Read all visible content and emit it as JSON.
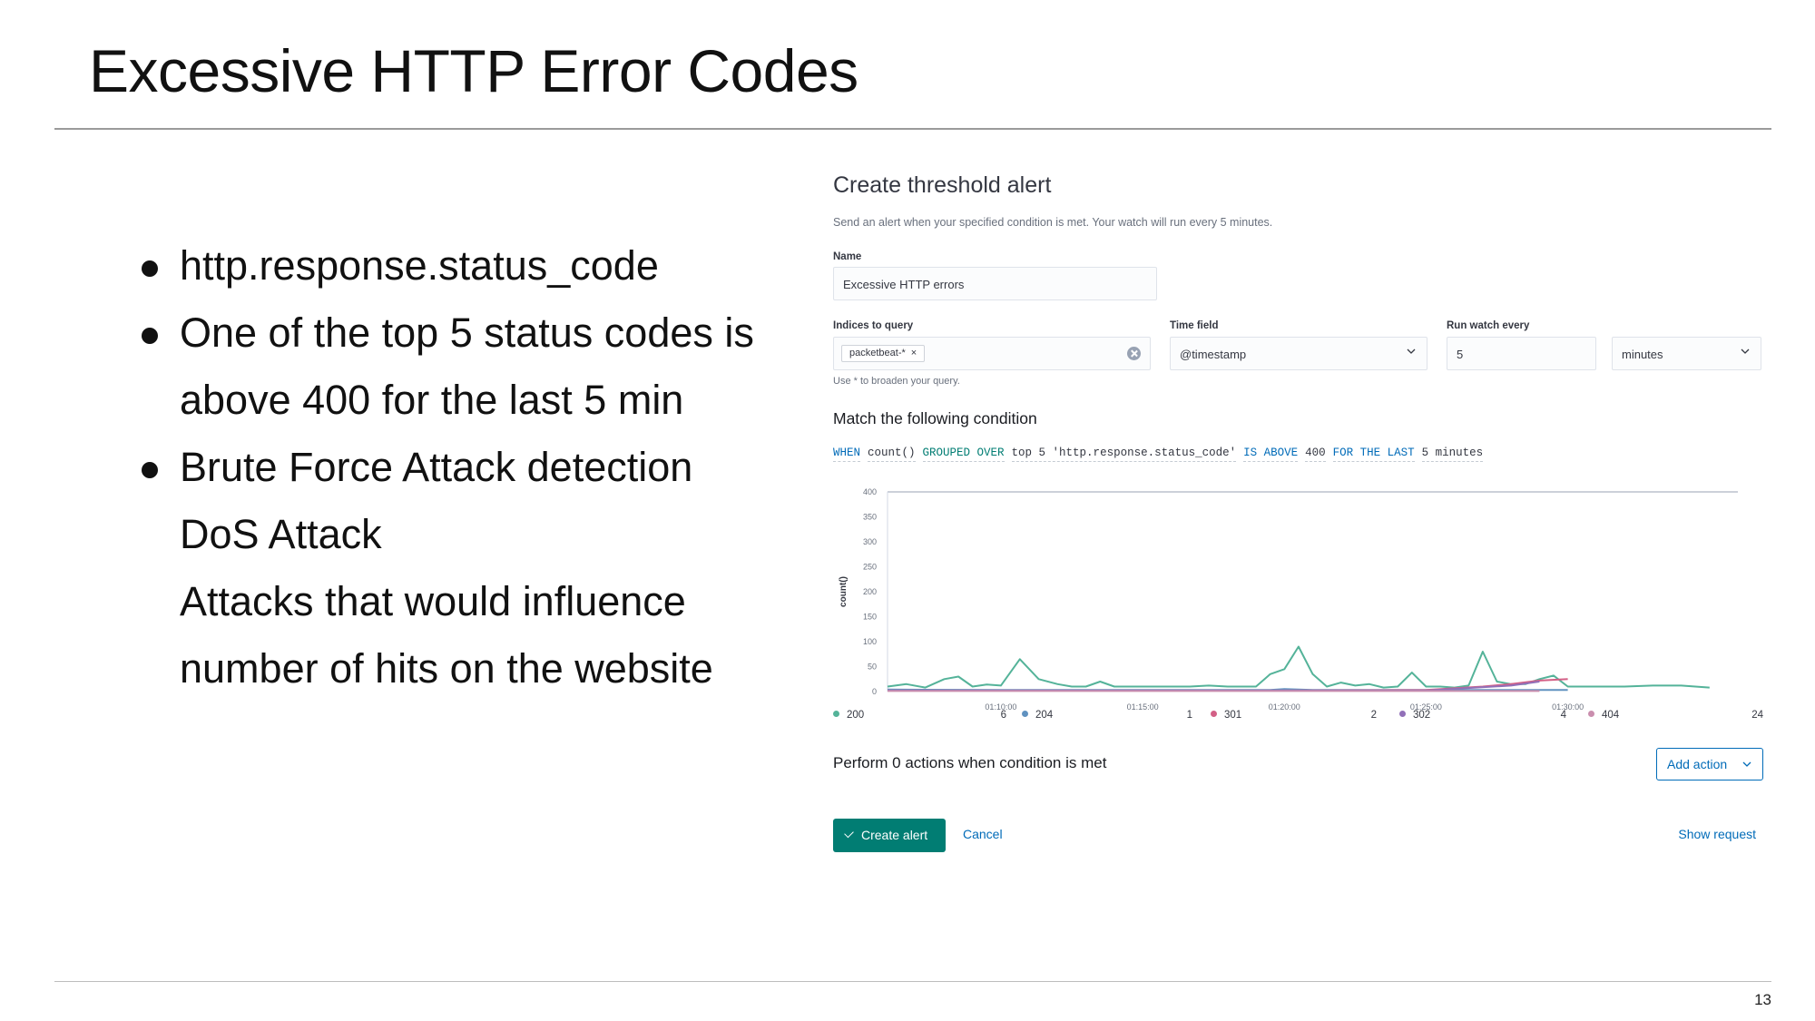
{
  "slide": {
    "title": "Excessive HTTP Error Codes",
    "page_number": "13",
    "bullets": [
      {
        "bullet": true,
        "text": "http.response.status_code"
      },
      {
        "bullet": true,
        "text": "One of the top 5 status codes is"
      },
      {
        "bullet": false,
        "text": "above 400 for the last 5 min"
      },
      {
        "bullet": true,
        "text": "Brute Force Attack detection"
      },
      {
        "bullet": false,
        "text": "DoS Attack"
      },
      {
        "bullet": false,
        "text": "Attacks that would influence"
      },
      {
        "bullet": false,
        "text": "number of hits on the website"
      }
    ]
  },
  "panel": {
    "title": "Create threshold alert",
    "description": "Send an alert when your specified condition is met. Your watch will run every 5 minutes.",
    "name_label": "Name",
    "name_value": "Excessive HTTP errors",
    "indices_label": "Indices to query",
    "indices_chip": "packetbeat-*",
    "indices_help": "Use * to broaden your query.",
    "time_field_label": "Time field",
    "time_field_value": "@timestamp",
    "run_every_label": "Run watch every",
    "run_every_value": "5",
    "run_every_unit": "minutes",
    "condition_title": "Match the following condition",
    "expression": {
      "when": "WHEN",
      "agg": "count()",
      "grouped_kw": "GROUPED OVER",
      "grouped_val": "top 5 'http.response.status_code'",
      "threshold_kw": "IS ABOVE",
      "threshold_val": "400",
      "window_kw": "FOR THE LAST",
      "window_val": "5 minutes"
    },
    "perform_text": "Perform 0 actions when condition is met",
    "add_action_label": "Add action",
    "create_label": "Create alert",
    "cancel_label": "Cancel",
    "show_request_label": "Show request"
  },
  "chart_data": {
    "type": "line",
    "ylabel": "count()",
    "ylim": [
      0,
      400
    ],
    "yticks": [
      0,
      50,
      100,
      150,
      200,
      250,
      300,
      350,
      400
    ],
    "xlim": [
      "01:06:00",
      "01:36:00"
    ],
    "xticks": [
      "01:10:00",
      "01:15:00",
      "01:20:00",
      "01:25:00",
      "01:30:00"
    ],
    "grid": false,
    "legend_position": "bottom",
    "legend_counts": [
      "6",
      "1",
      "2",
      "4",
      "24"
    ],
    "series": [
      {
        "name": "200",
        "color": "#54b399",
        "x": [
          "01:06:00",
          "01:06:40",
          "01:07:20",
          "01:08:00",
          "01:08:30",
          "01:09:00",
          "01:09:30",
          "01:10:00",
          "01:10:40",
          "01:11:20",
          "01:12:00",
          "01:12:30",
          "01:13:00",
          "01:13:30",
          "01:14:00",
          "01:14:30",
          "01:15:00",
          "01:15:30",
          "01:16:00",
          "01:16:40",
          "01:17:20",
          "01:18:00",
          "01:18:30",
          "01:19:00",
          "01:19:30",
          "01:20:00",
          "01:20:30",
          "01:21:00",
          "01:21:30",
          "01:22:00",
          "01:22:30",
          "01:23:00",
          "01:23:30",
          "01:24:00",
          "01:24:30",
          "01:25:00",
          "01:25:30",
          "01:26:00",
          "01:26:30",
          "01:27:00",
          "01:27:30",
          "01:28:00",
          "01:28:30",
          "01:29:00",
          "01:29:30",
          "01:30:00",
          "01:30:30",
          "01:31:00",
          "01:32:00",
          "01:33:00",
          "01:34:00",
          "01:35:00"
        ],
        "y": [
          10,
          15,
          8,
          25,
          30,
          10,
          14,
          12,
          65,
          25,
          15,
          10,
          10,
          20,
          10,
          10,
          10,
          10,
          10,
          10,
          12,
          10,
          10,
          10,
          35,
          45,
          90,
          35,
          10,
          18,
          12,
          15,
          8,
          10,
          38,
          10,
          10,
          8,
          12,
          80,
          20,
          15,
          15,
          25,
          32,
          10,
          10,
          10,
          10,
          12,
          12,
          8
        ]
      },
      {
        "name": "204",
        "color": "#6092c0",
        "x": [
          "01:06:00",
          "01:10:00",
          "01:15:00",
          "01:19:30",
          "01:20:00",
          "01:21:00",
          "01:25:00",
          "01:30:00"
        ],
        "y": [
          4,
          3,
          3,
          3,
          5,
          3,
          3,
          3
        ]
      },
      {
        "name": "301",
        "color": "#d36086",
        "x": [
          "01:06:00",
          "01:10:00",
          "01:15:00",
          "01:20:00",
          "01:25:00",
          "01:27:00",
          "01:28:00",
          "01:29:00",
          "01:30:00"
        ],
        "y": [
          2,
          2,
          2,
          2,
          3,
          10,
          15,
          22,
          25
        ]
      },
      {
        "name": "302",
        "color": "#9170b8",
        "x": [
          "01:06:00",
          "01:10:00",
          "01:15:00",
          "01:20:00",
          "01:25:00",
          "01:28:00",
          "01:29:00"
        ],
        "y": [
          2,
          2,
          2,
          2,
          2,
          12,
          20
        ]
      },
      {
        "name": "404",
        "color": "#ca8eae",
        "x": [
          "01:06:00",
          "01:15:00",
          "01:25:00",
          "01:28:00",
          "01:29:00"
        ],
        "y": [
          1,
          1,
          1,
          1,
          1
        ]
      }
    ]
  }
}
